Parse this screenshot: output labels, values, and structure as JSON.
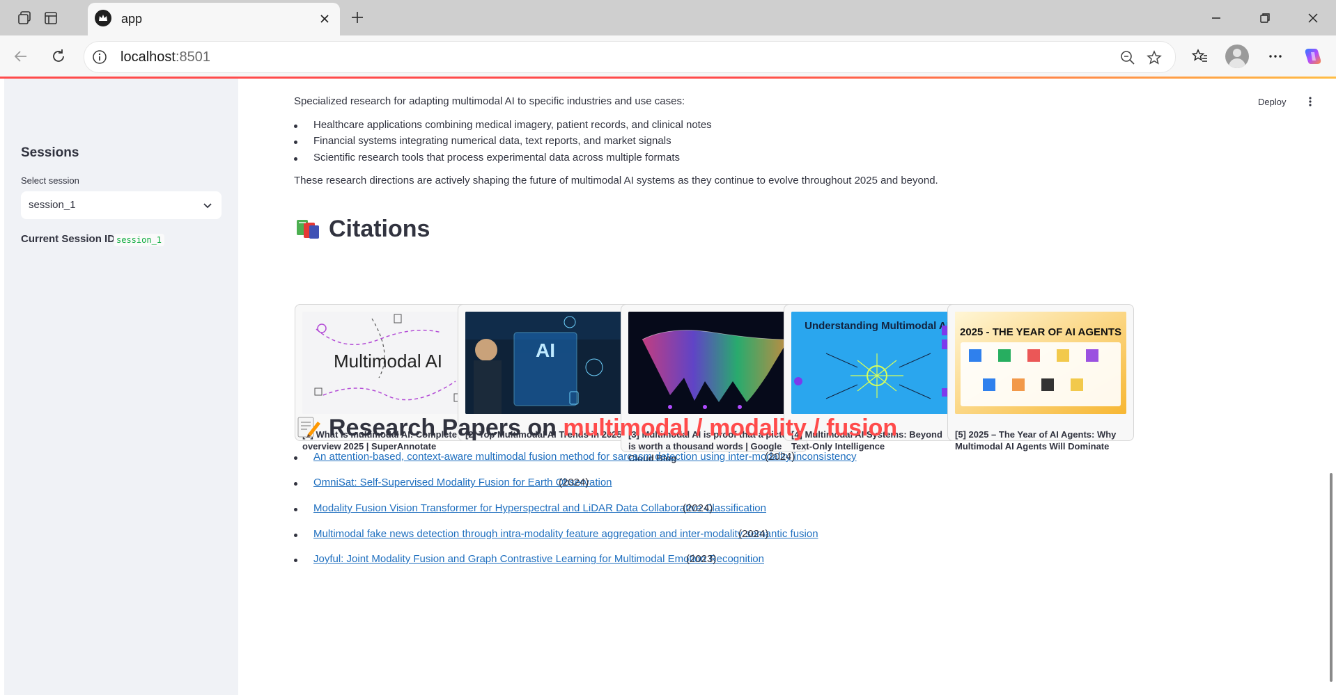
{
  "browser": {
    "tab_title": "app",
    "url_host": "localhost",
    "url_port": ":8501"
  },
  "sidebar": {
    "title": "Sessions",
    "select_label": "Select session",
    "select_value": "session_1",
    "current_label": "Current Session ID:",
    "current_value": "session_1"
  },
  "header": {
    "deploy_label": "Deploy"
  },
  "content": {
    "intro": "Specialized research for adapting multimodal AI to specific industries and use cases:",
    "bullets": [
      "Healthcare applications combining medical imagery, patient records, and clinical notes",
      "Financial systems integrating numerical data, text reports, and market signals",
      "Scientific research tools that process experimental data across multiple formats"
    ],
    "closing": "These research directions are actively shaping the future of multimodal AI systems as they continue to evolve throughout 2025 and beyond."
  },
  "citations": {
    "heading": "Citations",
    "cards": [
      {
        "caption": "[1] What is multimodal AI: Complete overview 2025 | SuperAnnotate",
        "image_text": "Multimodal AI"
      },
      {
        "caption": "[2] Top Multimodal AI Trends in 2025",
        "image_text": "AI"
      },
      {
        "caption": "[3] Multimodal AI is proof that a picture is worth a thousand words | Google Cloud Blog",
        "image_text": ""
      },
      {
        "caption": "[4] Multimodal AI Systems: Beyond Text-Only Intelligence",
        "image_text": "Understanding Multimodal AI"
      },
      {
        "caption": "[5] 2025 – The Year of AI Agents: Why Multimodal AI Agents Will Dominate",
        "image_text": "2025 - THE YEAR OF AI AGENTS"
      }
    ]
  },
  "papers": {
    "heading_prefix": "Research Papers on",
    "heading_accent": "multimodal / modality / fusion",
    "items": [
      {
        "title": "An attention-based, context-aware multimodal fusion method for sarcasm detection using inter-modality inconsistency",
        "year": "(2024)"
      },
      {
        "title": "OmniSat: Self-Supervised Modality Fusion for Earth Observation",
        "year": "(2024)"
      },
      {
        "title": "Modality Fusion Vision Transformer for Hyperspectral and LiDAR Data Collaborative Classification",
        "year": "(2024)"
      },
      {
        "title": "Multimodal fake news detection through intra-modality feature aggregation and inter-modality semantic fusion",
        "year": "(2024)"
      },
      {
        "title": "Joyful: Joint Modality Fusion and Graph Contrastive Learning for Multimodal Emotion Recognition",
        "year": "(2023)"
      }
    ]
  },
  "colors": {
    "accent": "#ff4b4b",
    "link": "#1f6fbf",
    "sidebar_bg": "#f0f2f6",
    "code_green": "#09ab3b"
  }
}
